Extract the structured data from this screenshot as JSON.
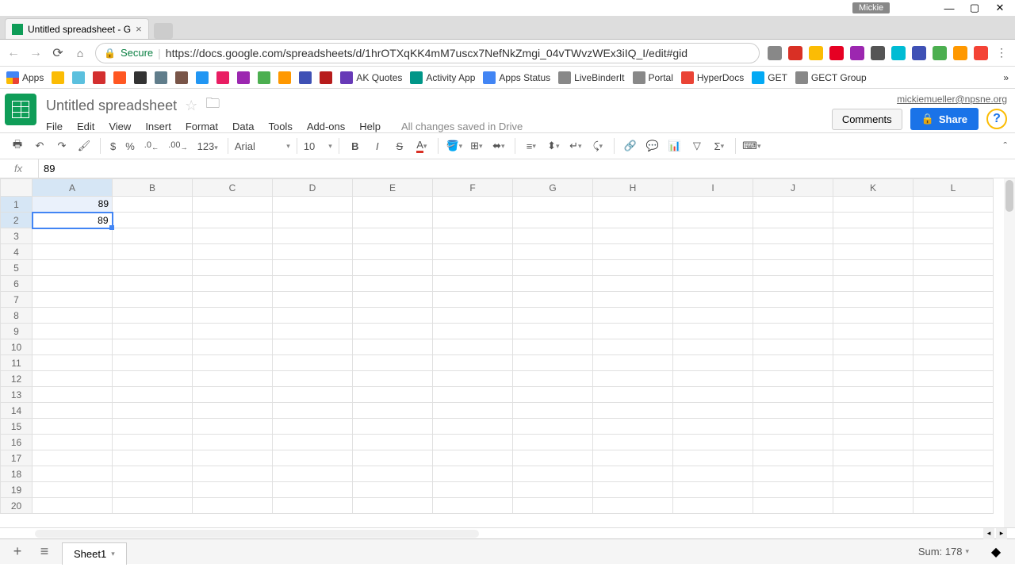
{
  "window": {
    "user_badge": "Mickie"
  },
  "browser": {
    "tab_title": "Untitled spreadsheet - G",
    "secure_label": "Secure",
    "url": "https://docs.google.com/spreadsheets/d/1hrOTXqKK4mM7uscx7NefNkZmgi_04vTWvzWEx3iIQ_I/edit#gid",
    "bookmarks": {
      "apps": "Apps",
      "ak_quotes": "AK Quotes",
      "activity_app": "Activity App",
      "apps_status": "Apps Status",
      "livebinderit": "LiveBinderIt",
      "portal": "Portal",
      "hyperdocs": "HyperDocs",
      "get": "GET",
      "gect_group": "GECT Group"
    }
  },
  "doc": {
    "title": "Untitled spreadsheet",
    "user_email": "mickiemueller@npsne.org",
    "menus": {
      "file": "File",
      "edit": "Edit",
      "view": "View",
      "insert": "Insert",
      "format": "Format",
      "data": "Data",
      "tools": "Tools",
      "addons": "Add-ons",
      "help": "Help"
    },
    "save_status": "All changes saved in Drive",
    "comments_btn": "Comments",
    "share_btn": "Share"
  },
  "toolbar": {
    "dollar": "$",
    "percent": "%",
    "dec_dec": ".0",
    "inc_dec": ".00",
    "num_format": "123",
    "font": "Arial",
    "size": "10"
  },
  "formula": {
    "fx": "fx",
    "value": "89"
  },
  "grid": {
    "columns": [
      "A",
      "B",
      "C",
      "D",
      "E",
      "F",
      "G",
      "H",
      "I",
      "J",
      "K",
      "L"
    ],
    "rows": 20,
    "cells": {
      "A1": "89",
      "A2": "89"
    },
    "selected_col": "A",
    "selected_rows": [
      1,
      2
    ]
  },
  "sheets": {
    "tab1": "Sheet1"
  },
  "status": {
    "sum": "Sum: 178"
  }
}
